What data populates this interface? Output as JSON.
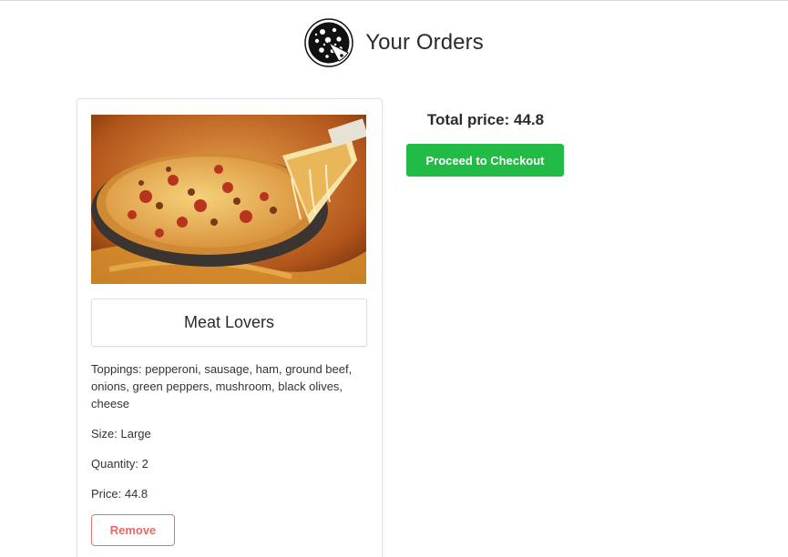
{
  "header": {
    "title": "Your Orders",
    "logo_icon": "pizza-icon"
  },
  "orders": [
    {
      "name": "Meat Lovers",
      "toppings_text": "Toppings: pepperoni, sausage, ham, ground beef, onions, green peppers, mushroom, black olives, cheese",
      "size_text": "Size: Large",
      "quantity_text": "Quantity: 2",
      "price_text": "Price: 44.8",
      "remove_label": "Remove",
      "image": "meat-lovers-pizza-photo"
    }
  ],
  "summary": {
    "total_text": "Total price: 44.8",
    "checkout_label": "Proceed to Checkout"
  },
  "colors": {
    "checkout_green": "#22bb45",
    "remove_red": "#e57373",
    "text_dark": "#2b2b2b"
  }
}
